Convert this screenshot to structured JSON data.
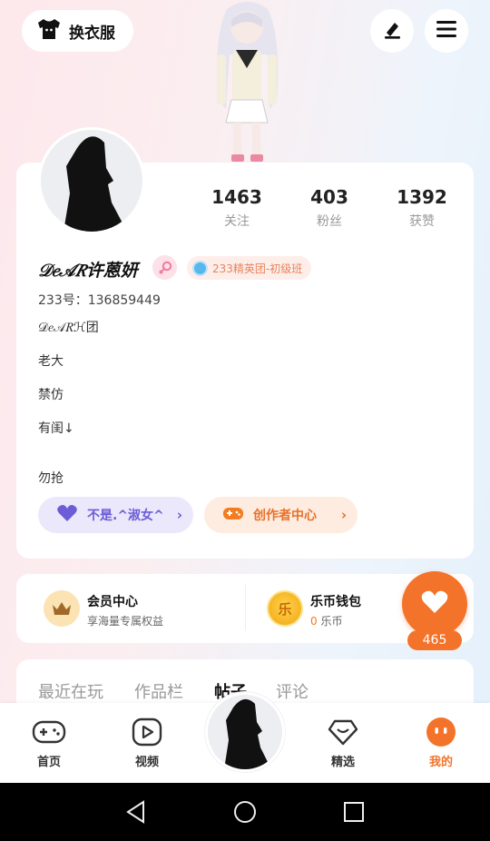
{
  "topbar": {
    "outfit_label": "换衣服",
    "icons": [
      "tshirt-icon",
      "edit-icon",
      "menu-icon"
    ]
  },
  "profile": {
    "stats": [
      {
        "value": "1463",
        "label": "关注"
      },
      {
        "value": "403",
        "label": "粉丝"
      },
      {
        "value": "1392",
        "label": "获赞"
      }
    ],
    "nickname": "𝒟𝑒𝒜𝑅许蒽妍",
    "gender": "female",
    "group_badge": "233精英团-初级班",
    "id_line": "233号：136859449",
    "bio_lines": [
      "𝒟𝑒𝒜𝑅ℋ团",
      "老大",
      "禁仿",
      "有闺↓",
      "勿抢"
    ],
    "pill_left": "不是.^淑女^",
    "pill_right": "创作者中心"
  },
  "wallet": {
    "member_title": "会员中心",
    "member_sub": "享海量专属权益",
    "coin_glyph": "乐",
    "wallet_title": "乐币钱包",
    "wallet_zero": "0",
    "wallet_unit": " 乐币",
    "likes": "465"
  },
  "tabs": [
    "最近在玩",
    "作品栏",
    "帖子",
    "评论"
  ],
  "nav": [
    {
      "label": "首页",
      "icon": "gamepad-icon"
    },
    {
      "label": "视频",
      "icon": "play-icon"
    },
    {
      "label": "精选",
      "icon": "heart-diamond-icon"
    },
    {
      "label": "我的",
      "icon": "face-icon"
    }
  ],
  "colors": {
    "accent": "#f4732a",
    "purple": "#6c5cd6"
  }
}
